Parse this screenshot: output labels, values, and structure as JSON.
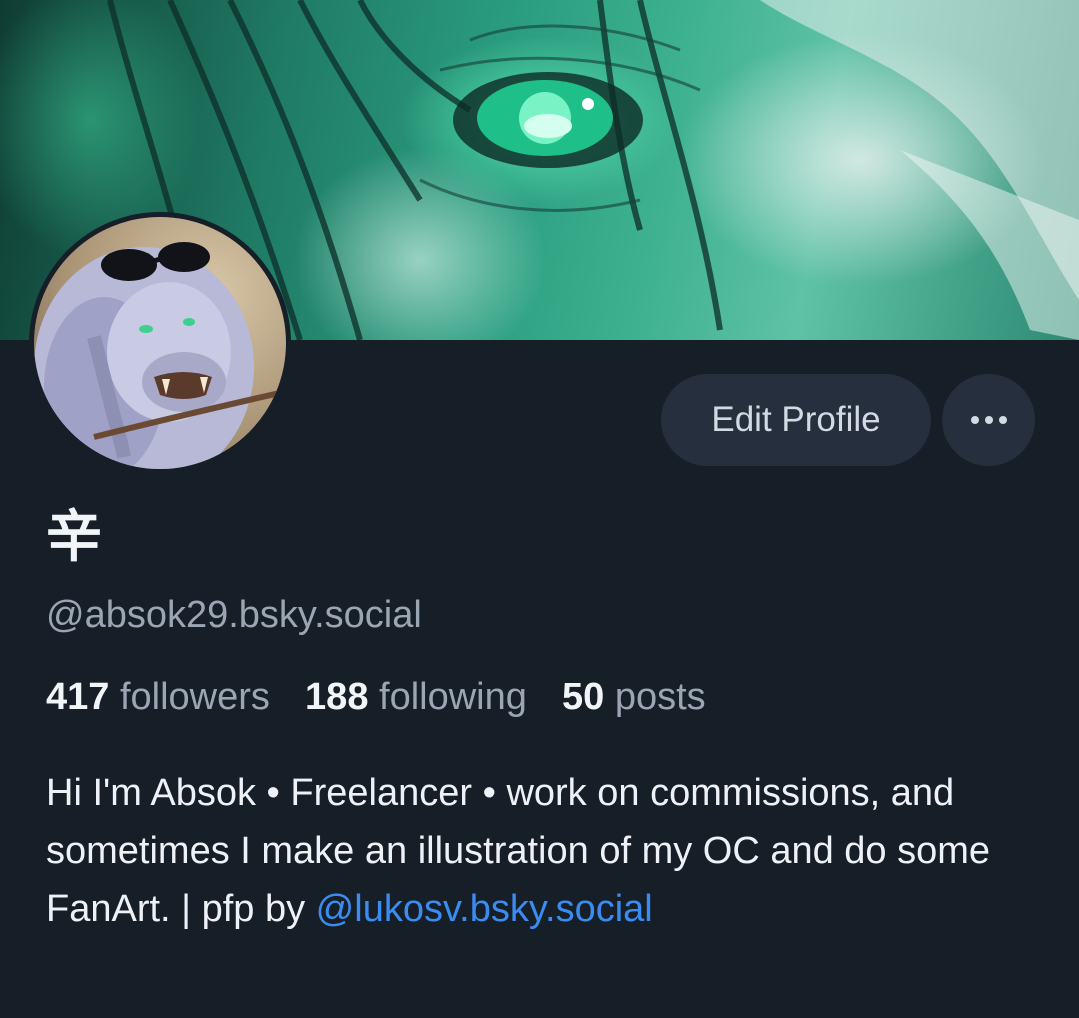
{
  "profile": {
    "display_name": "辛",
    "handle": "@absok29.bsky.social",
    "stats": {
      "followers_count": "417",
      "followers_label": "followers",
      "following_count": "188",
      "following_label": "following",
      "posts_count": "50",
      "posts_label": "posts"
    },
    "bio": {
      "text": "Hi I'm Absok • Freelancer • work on commissions, and sometimes I make an illustration of my OC and do some FanArt. | pfp by",
      "link_text": "@lukosv.bsky.social"
    }
  },
  "actions": {
    "edit_profile_label": "Edit Profile",
    "more_icon": "ellipsis-icon"
  },
  "colors": {
    "background": "#161e27",
    "button_bg": "#262f3d",
    "link": "#3b8cf0",
    "muted_text": "#9aa6b4"
  }
}
